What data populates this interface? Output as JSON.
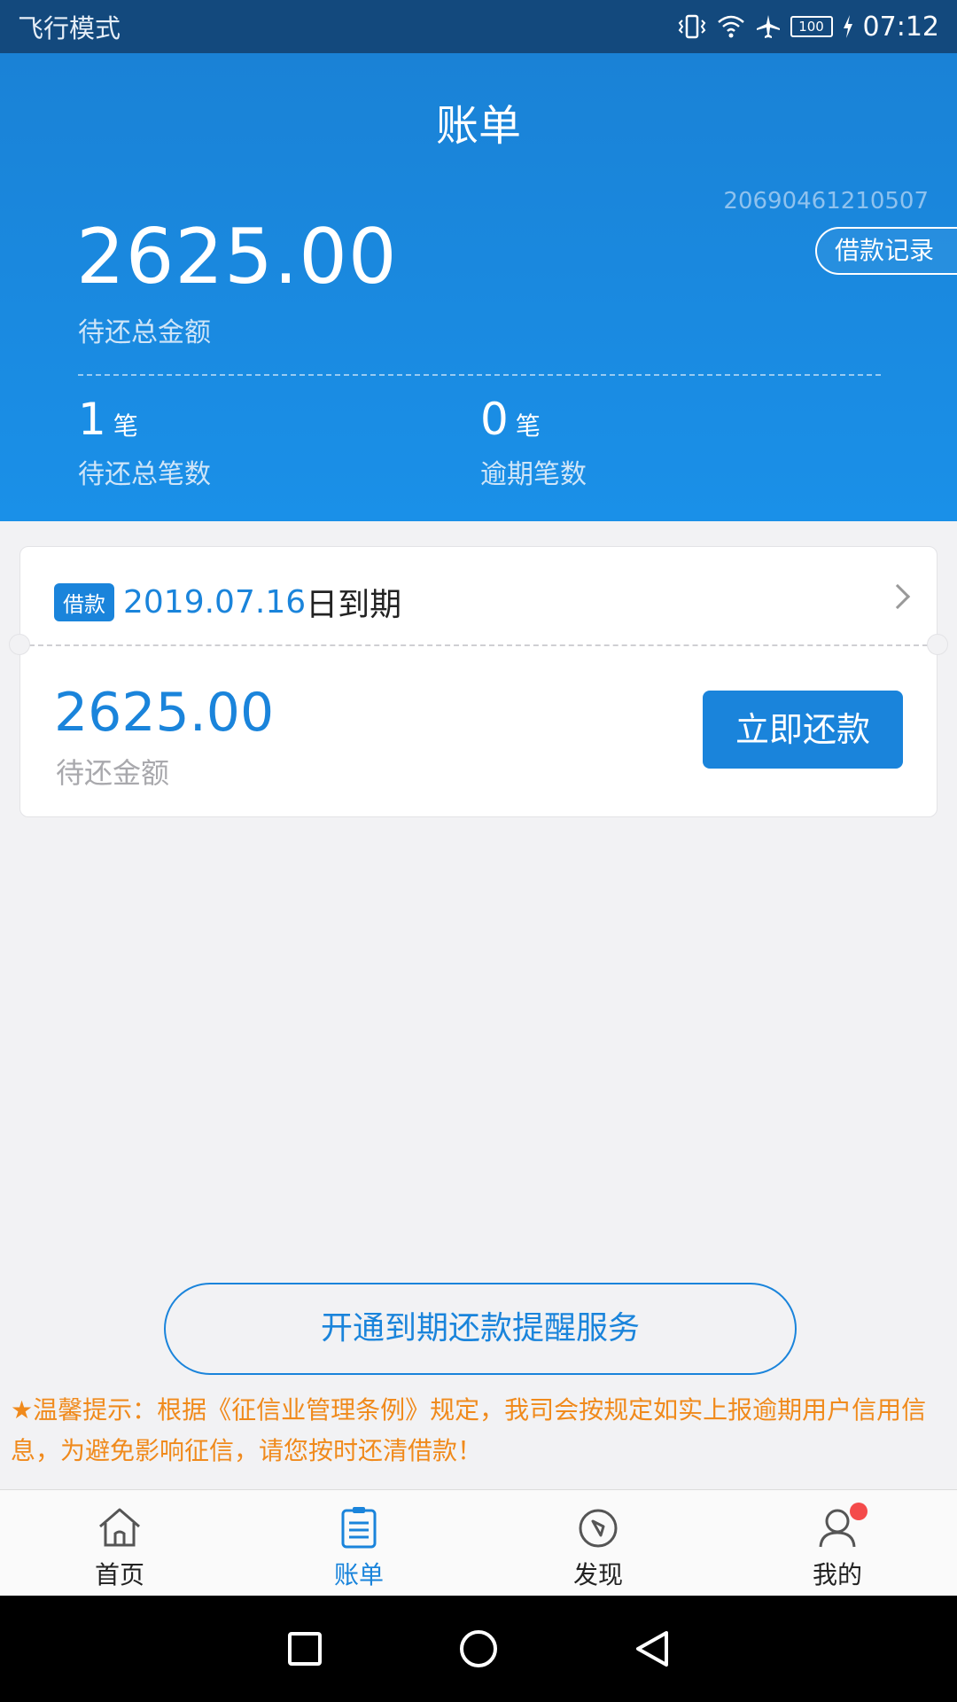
{
  "status_bar": {
    "mode": "飞行模式",
    "battery": "100",
    "time": "07:12"
  },
  "header": {
    "title": "账单",
    "account_no": "20690461210507",
    "records_button": "借款记录",
    "total_amount": "2625.00",
    "total_label": "待还总金额",
    "pending_count": "1",
    "pending_unit": "笔",
    "pending_label": "待还总笔数",
    "overdue_count": "0",
    "overdue_unit": "笔",
    "overdue_label": "逾期笔数"
  },
  "bill_card": {
    "badge": "借款",
    "due_date": "2019.07.16",
    "due_suffix": "日到期",
    "amount": "2625.00",
    "amount_label": "待还金额",
    "repay_button": "立即还款"
  },
  "reminder": {
    "button": "开通到期还款提醒服务",
    "tip": "★温馨提示：根据《征信业管理条例》规定，我司会按规定如实上报逾期用户信用信息，为避免影响征信，请您按时还清借款！"
  },
  "tabs": [
    {
      "label": "首页",
      "icon": "home-icon"
    },
    {
      "label": "账单",
      "icon": "bill-icon"
    },
    {
      "label": "发现",
      "icon": "compass-icon"
    },
    {
      "label": "我的",
      "icon": "user-icon"
    }
  ],
  "colors": {
    "accent": "#1a84db",
    "header_bg": "#1a88e0",
    "status_bar_bg": "#13497d",
    "tip_text": "#f08a1c",
    "notification_dot": "#f44b4b"
  }
}
